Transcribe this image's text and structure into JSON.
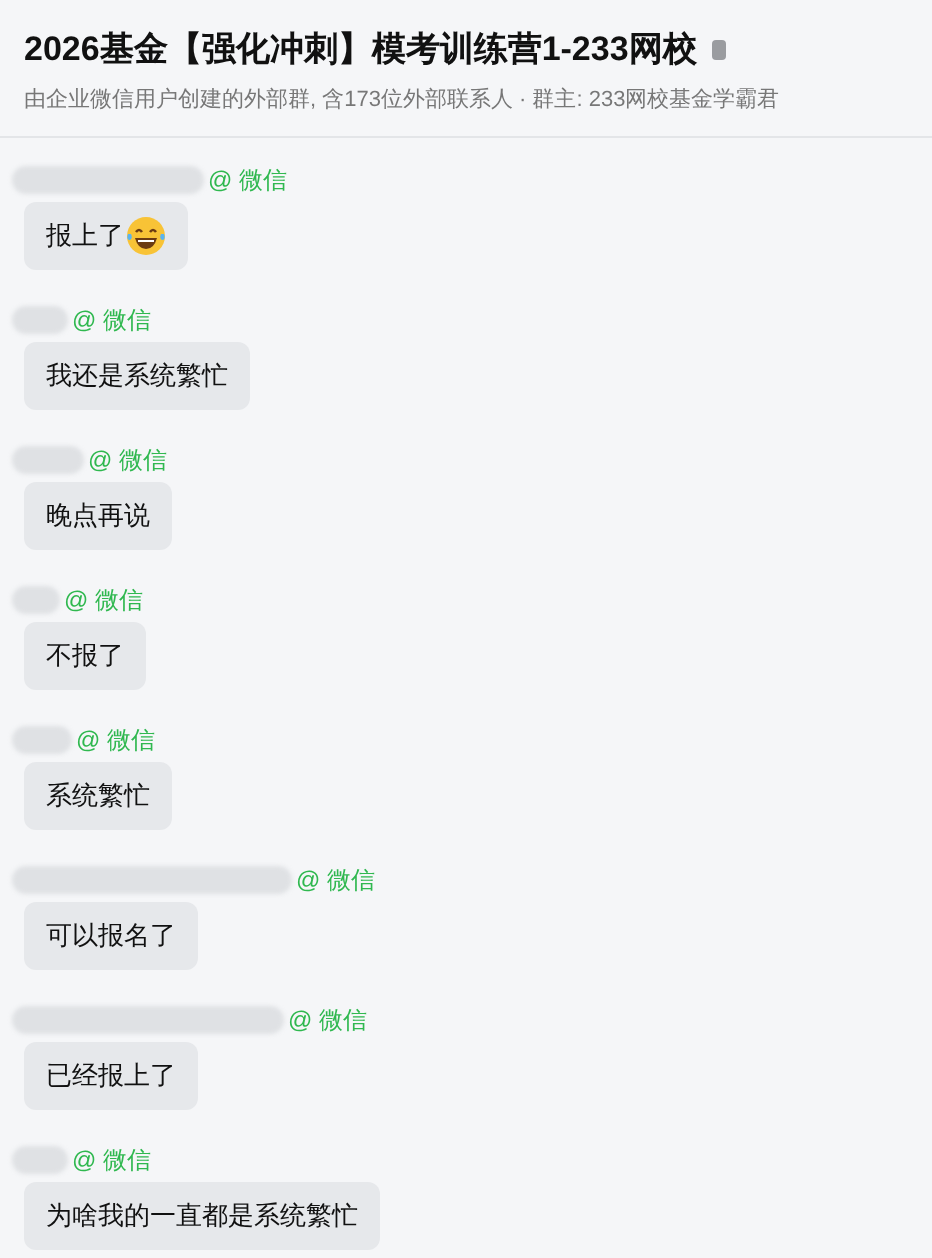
{
  "header": {
    "title": "2026基金【强化冲刺】模考训练营1-233网校",
    "subtitle": "由企业微信用户创建的外部群, 含173位外部联系人 · 群主: 233网校基金学霸君"
  },
  "messages": [
    {
      "source": "@ 微信",
      "text": "报上了",
      "emoji": true
    },
    {
      "source": "@ 微信",
      "text": "我还是系统繁忙",
      "emoji": false
    },
    {
      "source": "@ 微信",
      "text": "晚点再说",
      "emoji": false
    },
    {
      "source": "@ 微信",
      "text": "不报了",
      "emoji": false
    },
    {
      "source": "@ 微信",
      "text": "系统繁忙",
      "emoji": false
    },
    {
      "source": "@ 微信",
      "text": "可以报名了",
      "emoji": false
    },
    {
      "source": "@ 微信",
      "text": "已经报上了",
      "emoji": false
    },
    {
      "source": "@ 微信",
      "text": "为啥我的一直都是系统繁忙",
      "emoji": false
    }
  ]
}
